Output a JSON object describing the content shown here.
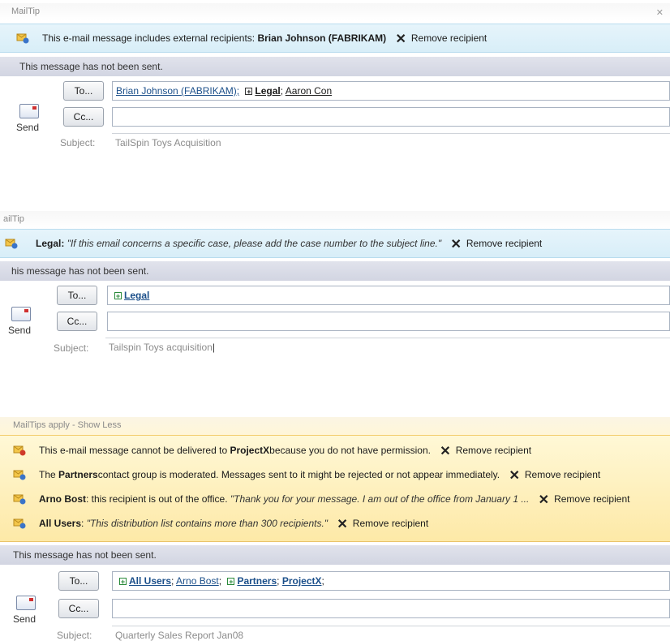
{
  "panel1": {
    "header": "MailTip",
    "tip": {
      "text": "This e-mail message includes external recipients:",
      "name": "Brian Johnson (FABRIKAM)",
      "remove": "Remove recipient"
    },
    "status": "This message has not been sent.",
    "send": "Send",
    "to_btn": "To...",
    "cc_btn": "Cc...",
    "recipients": [
      "Brian Johnson (FABRIKAM);",
      "Legal",
      ";",
      "Aaron Con"
    ],
    "subject_label": "Subject:",
    "subject": "TailSpin Toys Acquisition"
  },
  "panel2": {
    "header": "ailTip",
    "tip": {
      "name": "Legal",
      "colon": ":",
      "quote": "\"If this email concerns a specific case, please add the case number to the subject line.\"",
      "remove": "Remove recipient"
    },
    "status": "his message has not been sent.",
    "send": "Send",
    "to_btn": "To...",
    "cc_btn": "Cc...",
    "recipients": [
      "Legal"
    ],
    "subject_label": "Subject:",
    "subject": "Tailspin Toys acquisition"
  },
  "panel3": {
    "header": "MailTips apply  -  Show Less",
    "tips": [
      {
        "pre": "This e-mail message cannot be delivered to",
        "name": "ProjectX",
        "post": "because you do not have permission.",
        "remove": "Remove recipient"
      },
      {
        "pre": "The",
        "name": "Partners",
        "post": "contact group is moderated. Messages sent to it might be rejected or not appear immediately.",
        "remove": "Remove recipient"
      },
      {
        "name": "Arno Bost",
        "post": ": this recipient is out of the office.",
        "quote": "\"Thank you for your message. I am out of the office from January 1 ...",
        "remove": "Remove recipient"
      },
      {
        "name": "All Users",
        "post": ":",
        "quote": "\"This distribution list contains more than 300 recipients.\"",
        "remove": "Remove recipient"
      }
    ],
    "status": "This message has not been sent.",
    "send": "Send",
    "to_btn": "To...",
    "cc_btn": "Cc...",
    "recipients": [
      "All Users",
      ";",
      "Arno Bost",
      ";",
      "Partners",
      ";",
      "ProjectX",
      ";"
    ],
    "subject_label": "Subject:",
    "subject": "Quarterly Sales Report Jan08"
  },
  "colors": {
    "info_bar": "#d8eef8",
    "warn_bar": "#fde9a7",
    "status_bar": "#d2d5e2",
    "link": "#1b4f8a"
  }
}
